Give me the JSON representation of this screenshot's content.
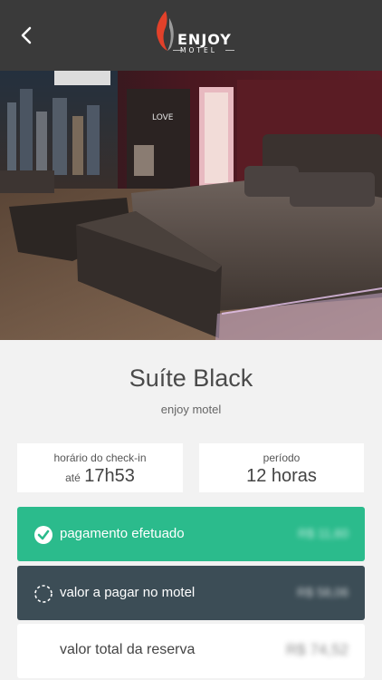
{
  "header": {
    "back_icon": "chevron-left-icon",
    "logo_name": "ENJOY",
    "logo_sub": "MOTEL"
  },
  "room": {
    "title": "Suíte Black",
    "venue": "enjoy motel"
  },
  "checkin": {
    "label": "horário do check-in",
    "prefix": "até",
    "time": "17h53"
  },
  "period": {
    "label": "período",
    "value": "12 horas"
  },
  "payments": {
    "paid_label": "pagamento efetuado",
    "paid_amount": "R$ 11,60",
    "paid_icon": "check-circle-icon",
    "due_label": "valor a pagar no motel",
    "due_amount": "R$ 58,06",
    "due_icon": "dashed-circle-icon",
    "total_label": "valor total da reserva",
    "total_amount": "R$ 74,52"
  },
  "colors": {
    "header_bg": "#3a3a3a",
    "paid_green": "#2bbb8c",
    "due_slate": "#3c4d56",
    "logo_red": "#e2412a"
  }
}
